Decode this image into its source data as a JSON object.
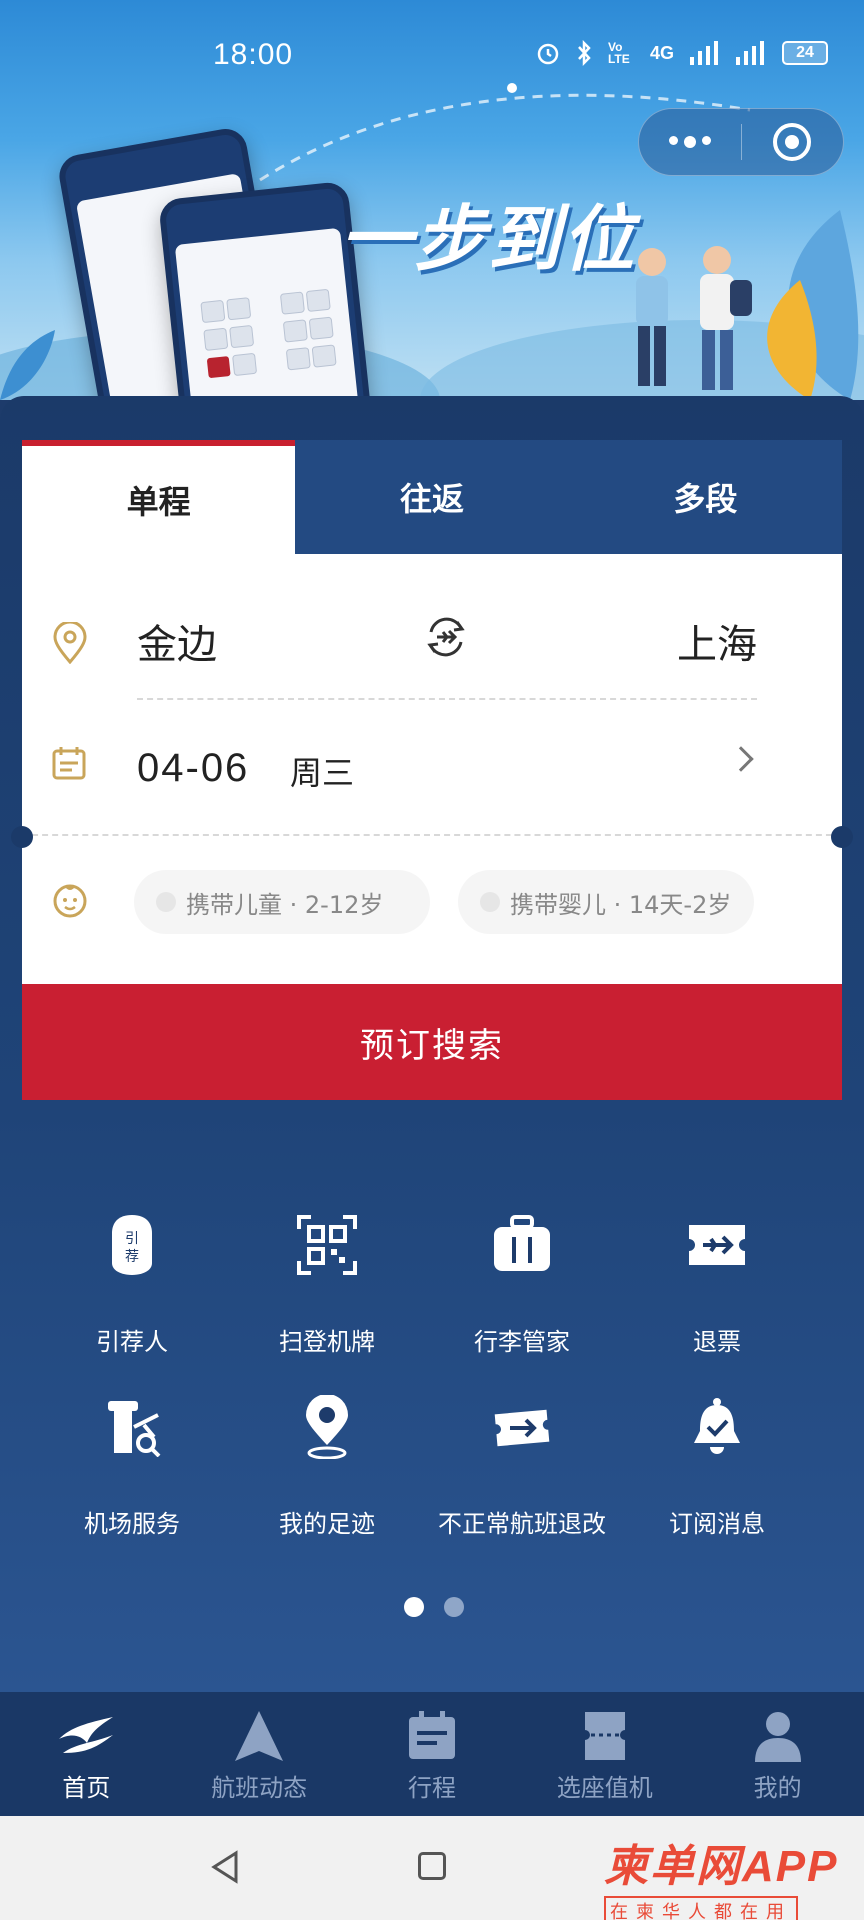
{
  "status_bar": {
    "time": "18:00",
    "network": "4G",
    "volte": "Vo LTE",
    "battery": "24"
  },
  "banner": {
    "slogan": "一步到位"
  },
  "trip_tabs": [
    {
      "label": "单程",
      "active": true
    },
    {
      "label": "往返",
      "active": false
    },
    {
      "label": "多段",
      "active": false
    }
  ],
  "route": {
    "from": "金边",
    "to": "上海"
  },
  "date": {
    "value": "04-06",
    "weekday": "周三"
  },
  "passengers": {
    "child": "携带儿童 · 2-12岁",
    "infant": "携带婴儿 · 14天-2岁"
  },
  "search_button": "预订搜索",
  "services": [
    {
      "label": "引荐人",
      "icon": "referrer-icon"
    },
    {
      "label": "扫登机牌",
      "icon": "qr-scan-icon"
    },
    {
      "label": "行李管家",
      "icon": "luggage-icon"
    },
    {
      "label": "退票",
      "icon": "refund-ticket-icon"
    },
    {
      "label": "机场服务",
      "icon": "airport-service-icon"
    },
    {
      "label": "我的足迹",
      "icon": "location-pin-icon"
    },
    {
      "label": "不正常航班退改",
      "icon": "irregular-flight-icon"
    },
    {
      "label": "订阅消息",
      "icon": "bell-icon"
    }
  ],
  "pager": {
    "pages": 2,
    "current": 1
  },
  "bottom_nav": [
    {
      "label": "首页",
      "icon": "home-logo-icon",
      "active": true
    },
    {
      "label": "航班动态",
      "icon": "flight-status-icon",
      "active": false
    },
    {
      "label": "行程",
      "icon": "itinerary-icon",
      "active": false
    },
    {
      "label": "选座值机",
      "icon": "seat-checkin-icon",
      "active": false
    },
    {
      "label": "我的",
      "icon": "profile-icon",
      "active": false
    }
  ],
  "watermark": {
    "main": "柬单网",
    "app": "APP",
    "sub": "在柬华人都在用"
  },
  "colors": {
    "primary_navy": "#1b3a69",
    "accent_red": "#c91f32",
    "gold_icon": "#c9a55a"
  }
}
